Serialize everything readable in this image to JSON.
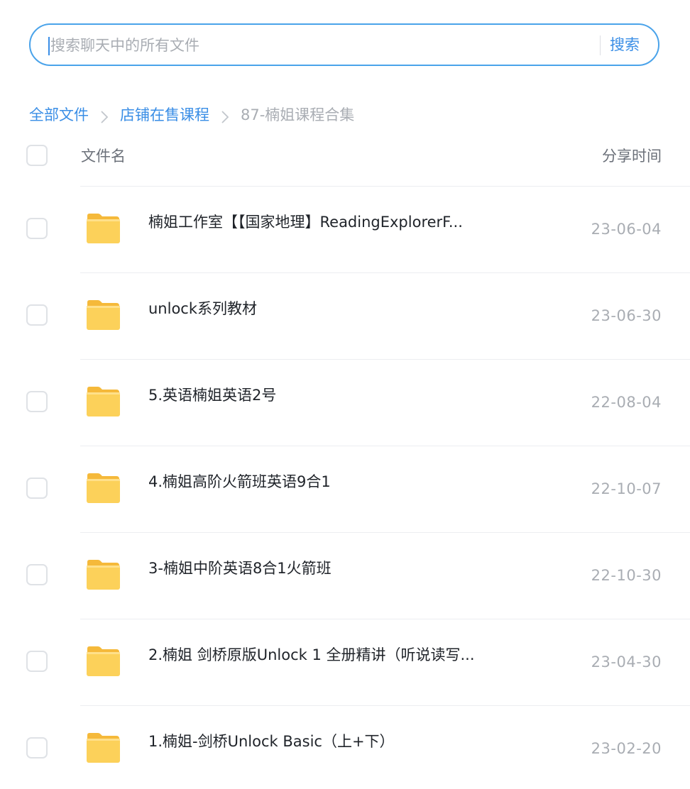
{
  "search": {
    "placeholder": "搜索聊天中的所有文件",
    "value": "",
    "button_label": "搜索"
  },
  "breadcrumb": {
    "items": [
      "全部文件",
      "店铺在售课程"
    ],
    "current": "87-楠姐课程合集"
  },
  "table_header": {
    "name_label": "文件名",
    "time_label": "分享时间"
  },
  "files": [
    {
      "name": "楠姐工作室【【国家地理】ReadingExplorerF...",
      "time": "23-06-04",
      "icon": "folder-icon"
    },
    {
      "name": "unlock系列教材",
      "time": "23-06-30",
      "icon": "folder-icon"
    },
    {
      "name": "5.英语楠姐英语2号",
      "time": "22-08-04",
      "icon": "folder-icon"
    },
    {
      "name": "4.楠姐高阶火箭班英语9合1",
      "time": "22-10-07",
      "icon": "folder-icon"
    },
    {
      "name": "3-楠姐中阶英语8合1火箭班",
      "time": "22-10-30",
      "icon": "folder-icon"
    },
    {
      "name": "2.楠姐 剑桥原版Unlock 1 全册精讲（听说读写...",
      "time": "23-04-30",
      "icon": "folder-icon"
    },
    {
      "name": "1.楠姐-剑桥Unlock Basic（上+下）",
      "time": "23-02-20",
      "icon": "folder-icon"
    }
  ],
  "colors": {
    "accent": "#3a8ee6",
    "search_border": "#4aa3ea",
    "muted_text": "#a9adb3",
    "primary_text": "#1f2329",
    "folder_yellow": "#fcd15a"
  }
}
